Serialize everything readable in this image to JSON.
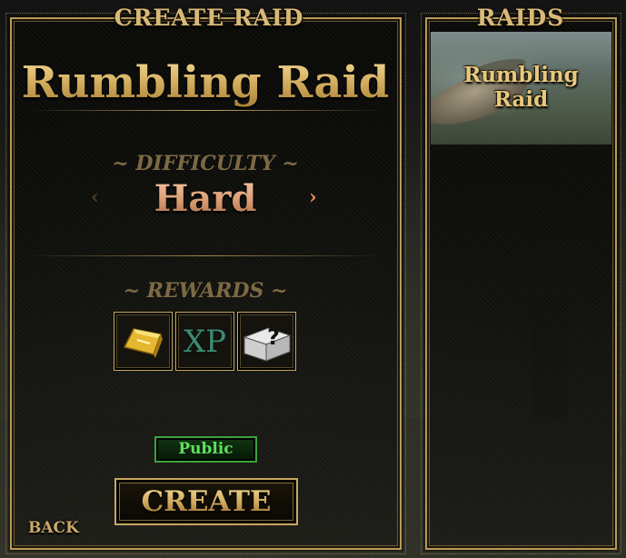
{
  "create_panel": {
    "header": "CREATE RAID",
    "raid_name": "Rumbling Raid",
    "difficulty_label": "~ DIFFICULTY ~",
    "difficulty_value": "Hard",
    "rewards_label": "~ REWARDS ~",
    "rewards": [
      {
        "name": "gold-bar-icon"
      },
      {
        "name": "xp-icon",
        "text": "XP"
      },
      {
        "name": "mystery-crate-icon"
      }
    ],
    "visibility_button": "Public",
    "create_button": "CREATE",
    "back_button": "BACK"
  },
  "raids_panel": {
    "header": "RAIDS",
    "cards": [
      {
        "label_line1": "Rumbling",
        "label_line2": "Raid"
      }
    ]
  },
  "colors": {
    "gold": "#d9b978",
    "frame": "#b89a55",
    "public_green": "#5fe05f",
    "difficulty_orange": "#e8a680"
  }
}
